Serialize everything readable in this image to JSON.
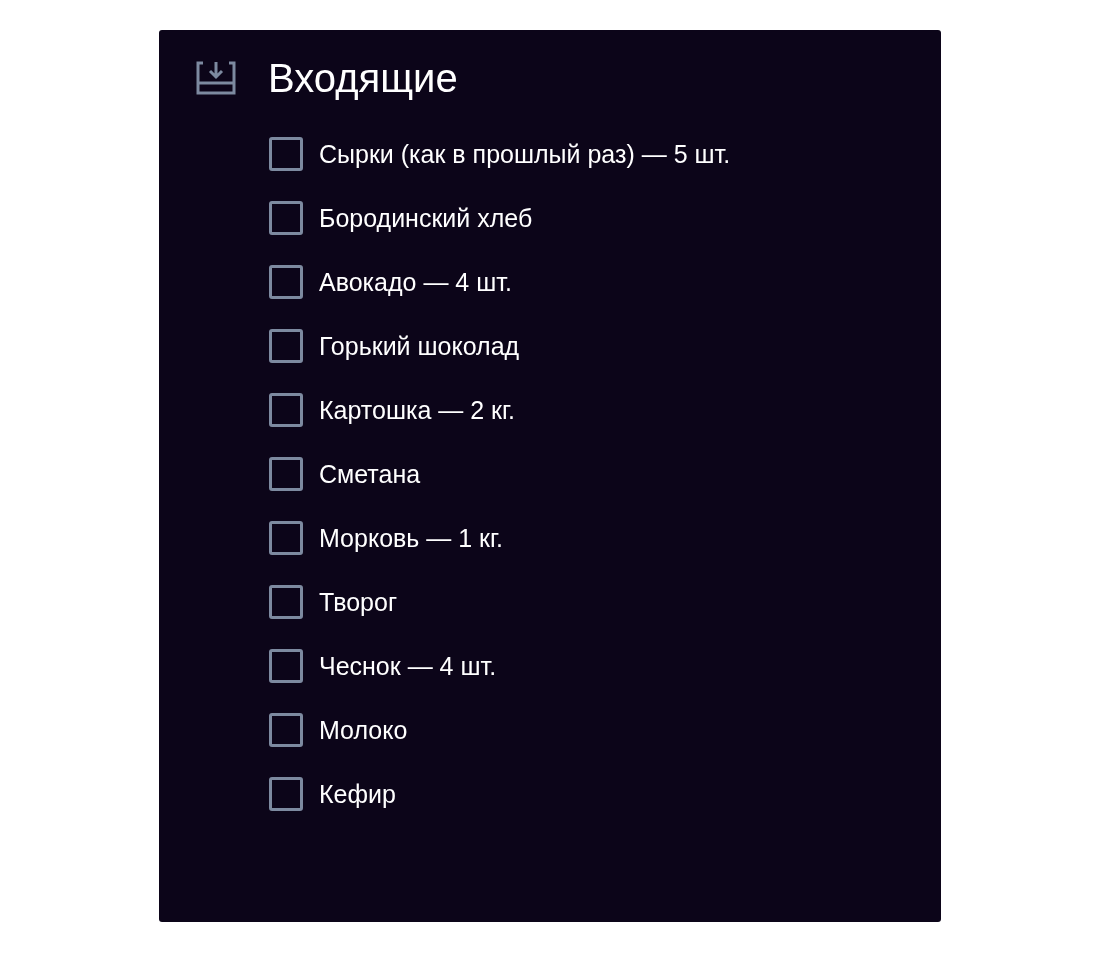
{
  "title": "Входящие",
  "items": [
    {
      "label": "Сырки (как в прошлый раз) — 5 шт.",
      "checked": false
    },
    {
      "label": "Бородинский хлеб",
      "checked": false
    },
    {
      "label": "Авокадо — 4 шт.",
      "checked": false
    },
    {
      "label": "Горький шоколад",
      "checked": false
    },
    {
      "label": "Картошка — 2 кг.",
      "checked": false
    },
    {
      "label": "Сметана",
      "checked": false
    },
    {
      "label": "Морковь — 1 кг.",
      "checked": false
    },
    {
      "label": "Творог",
      "checked": false
    },
    {
      "label": "Чеснок — 4 шт.",
      "checked": false
    },
    {
      "label": "Молоко",
      "checked": false
    },
    {
      "label": "Кефир",
      "checked": false
    }
  ]
}
